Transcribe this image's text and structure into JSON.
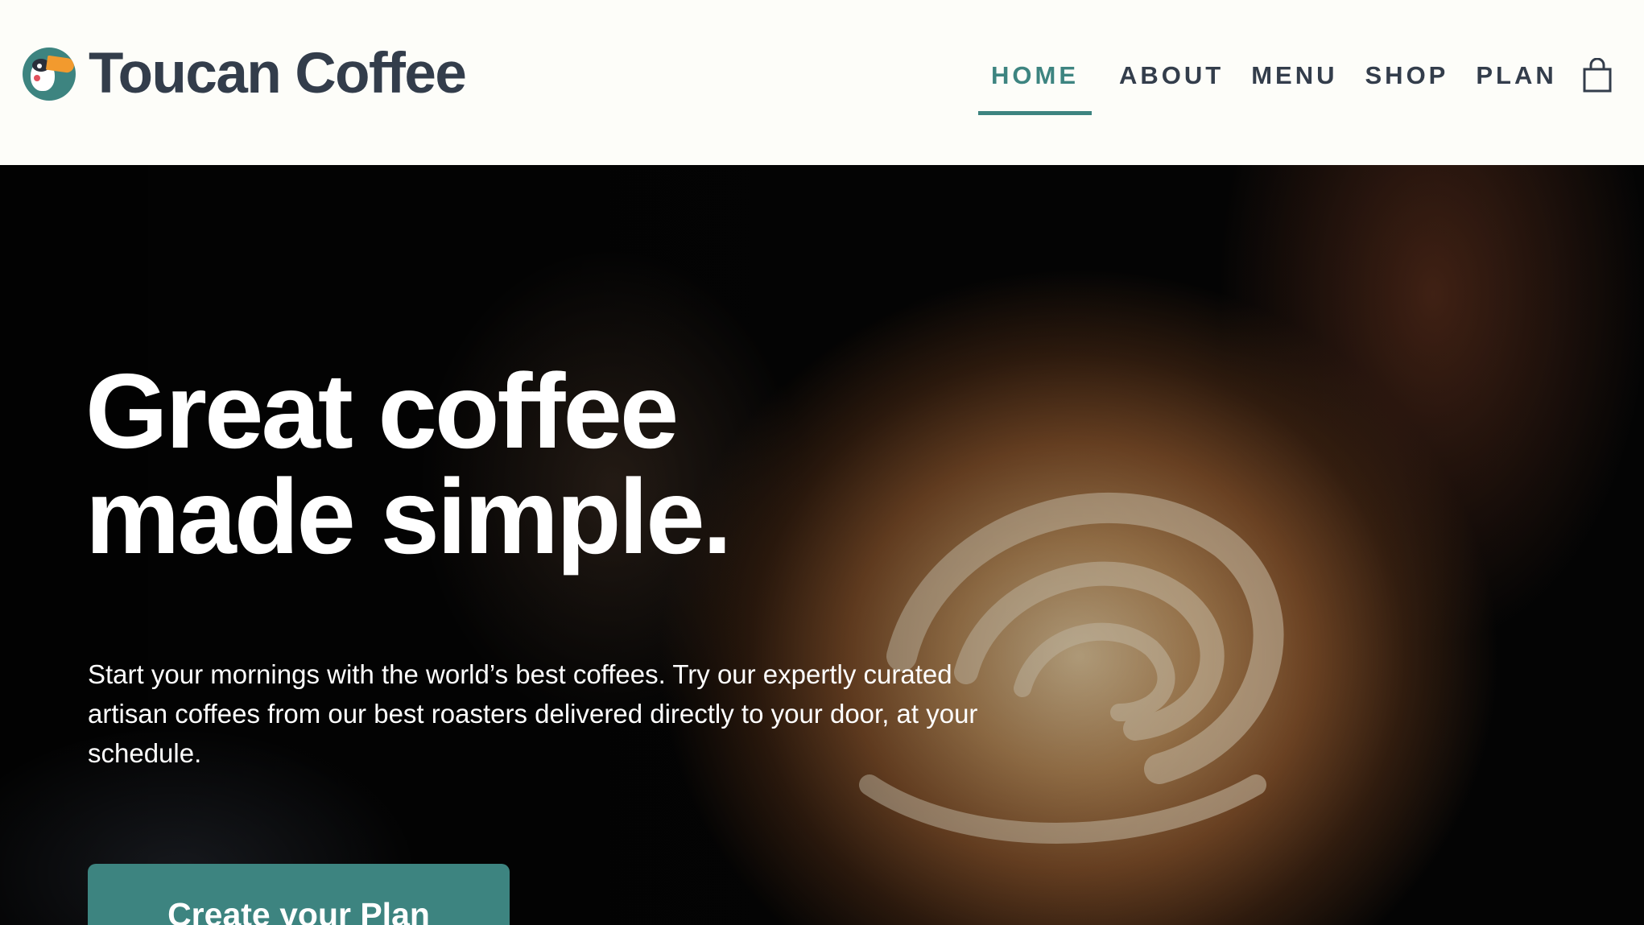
{
  "header": {
    "brand_name": "Toucan Coffee",
    "logo_icon": "toucan-logo",
    "nav": [
      {
        "label": "HOME",
        "active": true
      },
      {
        "label": "ABOUT",
        "active": false
      },
      {
        "label": "MENU",
        "active": false
      },
      {
        "label": "SHOP",
        "active": false
      },
      {
        "label": "PLAN",
        "active": false
      }
    ],
    "cart_icon": "shopping-bag-icon"
  },
  "hero": {
    "headline": "Great coffee made simple.",
    "subtext": "Start your mornings with the world’s best coffees. Try our expertly curated artisan coffees from our best roasters delivered directly to your door, at your schedule.",
    "cta_label": "Create your Plan",
    "background_image": "latte-art-pour"
  },
  "colors": {
    "accent": "#3d8480",
    "text_dark": "#333d4b",
    "header_bg": "#fdfdf9"
  }
}
